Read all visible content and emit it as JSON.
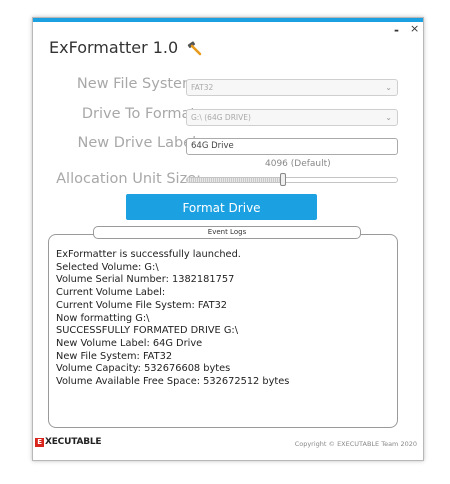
{
  "window": {
    "title": "ExFormatter 1.0",
    "minimize_label": "-",
    "close_label": "×"
  },
  "form": {
    "file_system": {
      "label": "New File System:",
      "value": "FAT32"
    },
    "drive": {
      "label": "Drive To Format:",
      "value": "G:\\ (64G DRIVE)"
    },
    "drive_label": {
      "label": "New Drive Label:",
      "value": "64G Drive"
    },
    "allocation": {
      "label": "Allocation Unit Size:",
      "value": "4096 (Default)",
      "slider_fraction": 0.45
    }
  },
  "format_button": {
    "label": "Format Drive"
  },
  "event_logs": {
    "title": "Event Logs",
    "lines": [
      "ExFormatter is successfully launched.",
      "Selected Volume: G:\\",
      "Volume Serial Number: 1382181757",
      "Current Volume Label:",
      "Current Volume File System: FAT32",
      "Now formatting G:\\",
      "SUCCESSFULLY FORMATED DRIVE G:\\",
      "New Volume Label: 64G Drive",
      "New File System: FAT32",
      "Volume Capacity: 532676608 bytes",
      "Volume Available Free Space: 532672512 bytes"
    ]
  },
  "footer": {
    "brand": "XECUTABLE",
    "brand_mark": "E",
    "copyright": "Copyright © EXECUTABLE Team 2020"
  },
  "colors": {
    "accent": "#1ba1e2",
    "brand_red": "#d9261c"
  },
  "icons": {
    "title_icon": "hammer-icon",
    "dropdown": "chevron-down-icon"
  }
}
